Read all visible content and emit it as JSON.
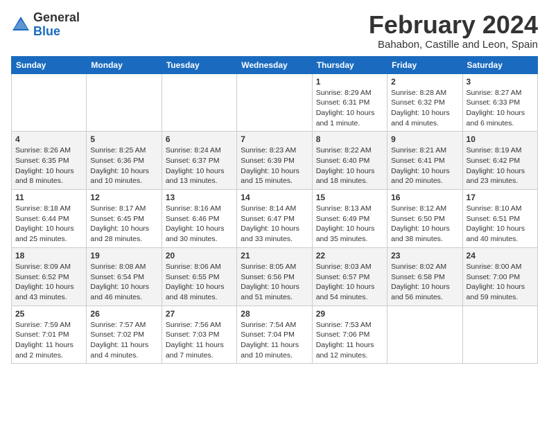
{
  "header": {
    "logo_general": "General",
    "logo_blue": "Blue",
    "month_title": "February 2024",
    "subtitle": "Bahabon, Castille and Leon, Spain"
  },
  "days_of_week": [
    "Sunday",
    "Monday",
    "Tuesday",
    "Wednesday",
    "Thursday",
    "Friday",
    "Saturday"
  ],
  "weeks": [
    [
      {
        "day": "",
        "info": ""
      },
      {
        "day": "",
        "info": ""
      },
      {
        "day": "",
        "info": ""
      },
      {
        "day": "",
        "info": ""
      },
      {
        "day": "1",
        "info": "Sunrise: 8:29 AM\nSunset: 6:31 PM\nDaylight: 10 hours\nand 1 minute."
      },
      {
        "day": "2",
        "info": "Sunrise: 8:28 AM\nSunset: 6:32 PM\nDaylight: 10 hours\nand 4 minutes."
      },
      {
        "day": "3",
        "info": "Sunrise: 8:27 AM\nSunset: 6:33 PM\nDaylight: 10 hours\nand 6 minutes."
      }
    ],
    [
      {
        "day": "4",
        "info": "Sunrise: 8:26 AM\nSunset: 6:35 PM\nDaylight: 10 hours\nand 8 minutes."
      },
      {
        "day": "5",
        "info": "Sunrise: 8:25 AM\nSunset: 6:36 PM\nDaylight: 10 hours\nand 10 minutes."
      },
      {
        "day": "6",
        "info": "Sunrise: 8:24 AM\nSunset: 6:37 PM\nDaylight: 10 hours\nand 13 minutes."
      },
      {
        "day": "7",
        "info": "Sunrise: 8:23 AM\nSunset: 6:39 PM\nDaylight: 10 hours\nand 15 minutes."
      },
      {
        "day": "8",
        "info": "Sunrise: 8:22 AM\nSunset: 6:40 PM\nDaylight: 10 hours\nand 18 minutes."
      },
      {
        "day": "9",
        "info": "Sunrise: 8:21 AM\nSunset: 6:41 PM\nDaylight: 10 hours\nand 20 minutes."
      },
      {
        "day": "10",
        "info": "Sunrise: 8:19 AM\nSunset: 6:42 PM\nDaylight: 10 hours\nand 23 minutes."
      }
    ],
    [
      {
        "day": "11",
        "info": "Sunrise: 8:18 AM\nSunset: 6:44 PM\nDaylight: 10 hours\nand 25 minutes."
      },
      {
        "day": "12",
        "info": "Sunrise: 8:17 AM\nSunset: 6:45 PM\nDaylight: 10 hours\nand 28 minutes."
      },
      {
        "day": "13",
        "info": "Sunrise: 8:16 AM\nSunset: 6:46 PM\nDaylight: 10 hours\nand 30 minutes."
      },
      {
        "day": "14",
        "info": "Sunrise: 8:14 AM\nSunset: 6:47 PM\nDaylight: 10 hours\nand 33 minutes."
      },
      {
        "day": "15",
        "info": "Sunrise: 8:13 AM\nSunset: 6:49 PM\nDaylight: 10 hours\nand 35 minutes."
      },
      {
        "day": "16",
        "info": "Sunrise: 8:12 AM\nSunset: 6:50 PM\nDaylight: 10 hours\nand 38 minutes."
      },
      {
        "day": "17",
        "info": "Sunrise: 8:10 AM\nSunset: 6:51 PM\nDaylight: 10 hours\nand 40 minutes."
      }
    ],
    [
      {
        "day": "18",
        "info": "Sunrise: 8:09 AM\nSunset: 6:52 PM\nDaylight: 10 hours\nand 43 minutes."
      },
      {
        "day": "19",
        "info": "Sunrise: 8:08 AM\nSunset: 6:54 PM\nDaylight: 10 hours\nand 46 minutes."
      },
      {
        "day": "20",
        "info": "Sunrise: 8:06 AM\nSunset: 6:55 PM\nDaylight: 10 hours\nand 48 minutes."
      },
      {
        "day": "21",
        "info": "Sunrise: 8:05 AM\nSunset: 6:56 PM\nDaylight: 10 hours\nand 51 minutes."
      },
      {
        "day": "22",
        "info": "Sunrise: 8:03 AM\nSunset: 6:57 PM\nDaylight: 10 hours\nand 54 minutes."
      },
      {
        "day": "23",
        "info": "Sunrise: 8:02 AM\nSunset: 6:58 PM\nDaylight: 10 hours\nand 56 minutes."
      },
      {
        "day": "24",
        "info": "Sunrise: 8:00 AM\nSunset: 7:00 PM\nDaylight: 10 hours\nand 59 minutes."
      }
    ],
    [
      {
        "day": "25",
        "info": "Sunrise: 7:59 AM\nSunset: 7:01 PM\nDaylight: 11 hours\nand 2 minutes."
      },
      {
        "day": "26",
        "info": "Sunrise: 7:57 AM\nSunset: 7:02 PM\nDaylight: 11 hours\nand 4 minutes."
      },
      {
        "day": "27",
        "info": "Sunrise: 7:56 AM\nSunset: 7:03 PM\nDaylight: 11 hours\nand 7 minutes."
      },
      {
        "day": "28",
        "info": "Sunrise: 7:54 AM\nSunset: 7:04 PM\nDaylight: 11 hours\nand 10 minutes."
      },
      {
        "day": "29",
        "info": "Sunrise: 7:53 AM\nSunset: 7:06 PM\nDaylight: 11 hours\nand 12 minutes."
      },
      {
        "day": "",
        "info": ""
      },
      {
        "day": "",
        "info": ""
      }
    ]
  ]
}
